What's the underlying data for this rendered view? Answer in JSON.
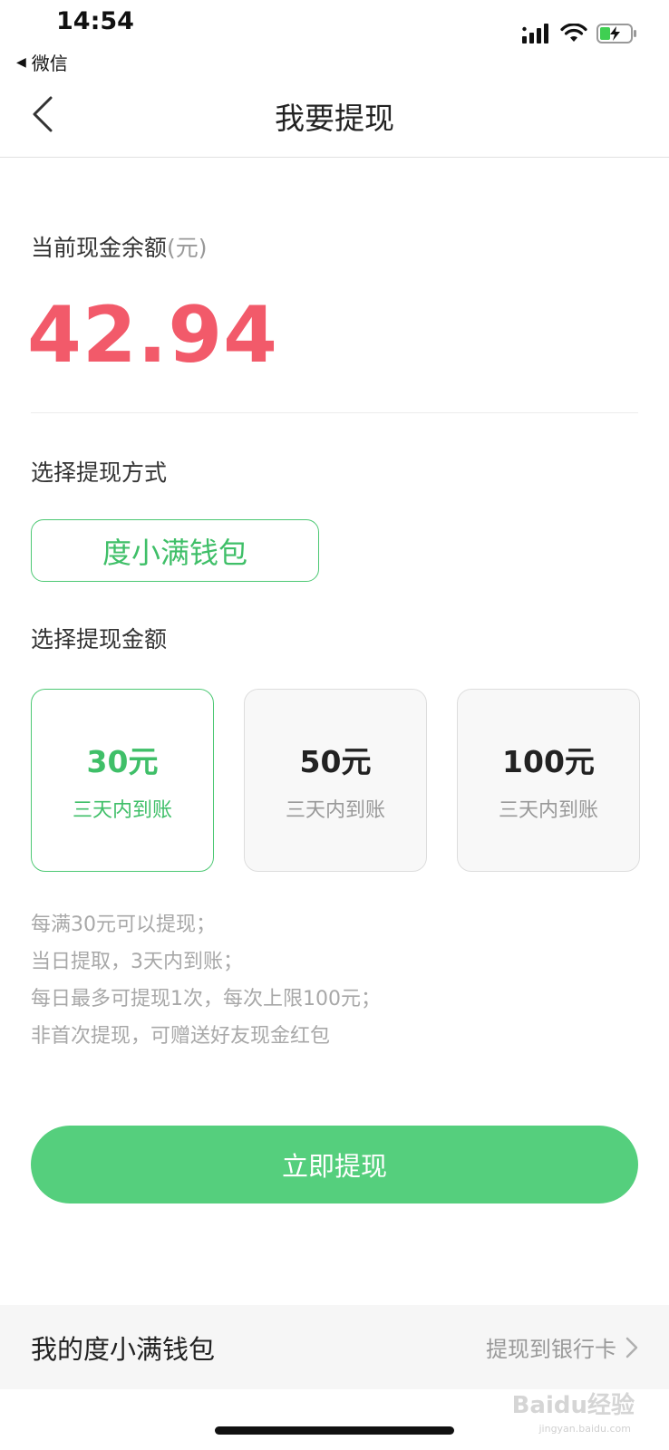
{
  "status_bar": {
    "time": "14:54",
    "back_app": "微信"
  },
  "header": {
    "title": "我要提现"
  },
  "balance": {
    "label": "当前现金余额",
    "unit": "(元)",
    "amount": "42.94"
  },
  "method": {
    "label": "选择提现方式",
    "option": "度小满钱包"
  },
  "amount_select": {
    "label": "选择提现金额",
    "options": [
      {
        "value": "30元",
        "note": "三天内到账",
        "selected": true
      },
      {
        "value": "50元",
        "note": "三天内到账",
        "selected": false
      },
      {
        "value": "100元",
        "note": "三天内到账",
        "selected": false
      }
    ]
  },
  "rules": [
    "每满30元可以提现；",
    "当日提取，3天内到账；",
    "每日最多可提现1次，每次上限100元；",
    "非首次提现，可赠送好友现金红包"
  ],
  "action": {
    "withdraw_label": "立即提现"
  },
  "footer": {
    "title": "我的度小满钱包",
    "link": "提现到银行卡"
  },
  "watermark": {
    "brand": "Baidu经验",
    "url": "jingyan.baidu.com"
  },
  "colors": {
    "accent_green": "#55cf7d",
    "amount_red": "#f25a6a"
  }
}
